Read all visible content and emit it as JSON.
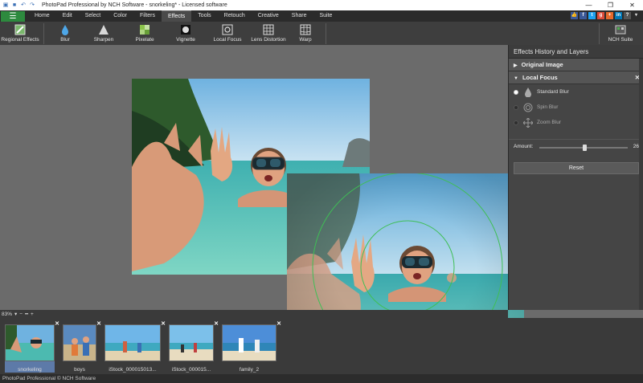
{
  "app": {
    "title": "PhotoPad Professional by NCH Software - snorkeling* - Licensed software"
  },
  "menu": {
    "tabs": [
      {
        "label": "Home"
      },
      {
        "label": "Edit"
      },
      {
        "label": "Select"
      },
      {
        "label": "Color"
      },
      {
        "label": "Filters"
      },
      {
        "label": "Effects",
        "active": true
      },
      {
        "label": "Tools"
      },
      {
        "label": "Retouch"
      },
      {
        "label": "Creative"
      },
      {
        "label": "Share"
      },
      {
        "label": "Suite"
      }
    ]
  },
  "toolbar": {
    "regional_effects": "Regional Effects",
    "blur": "Blur",
    "sharpen": "Sharpen",
    "pixelate": "Pixelate",
    "vignette": "Vignette",
    "local_focus": "Local Focus",
    "lens_distortion": "Lens Distortion",
    "warp": "Warp",
    "nch_suite": "NCH Suite"
  },
  "panel": {
    "header": "Effects History and Layers",
    "layers": [
      {
        "label": "Original Image"
      },
      {
        "label": "Local Focus"
      }
    ],
    "options": [
      {
        "label": "Standard Blur",
        "selected": true
      },
      {
        "label": "Spin Blur",
        "selected": false
      },
      {
        "label": "Zoom Blur",
        "selected": false
      }
    ],
    "amount_label": "Amount:",
    "amount_value": "26",
    "reset_label": "Reset"
  },
  "zoom": {
    "level": "83%"
  },
  "filmstrip": [
    {
      "label": "snorkeling"
    },
    {
      "label": "boys"
    },
    {
      "label": "iStock_000015013..."
    },
    {
      "label": "iStock_000015..."
    },
    {
      "label": "family_2"
    }
  ],
  "status": {
    "text": "PhotoPad Professional © NCH Software"
  },
  "colors": {
    "accent_green": "#2d8a3e",
    "focus_ring": "#3fbf55"
  }
}
